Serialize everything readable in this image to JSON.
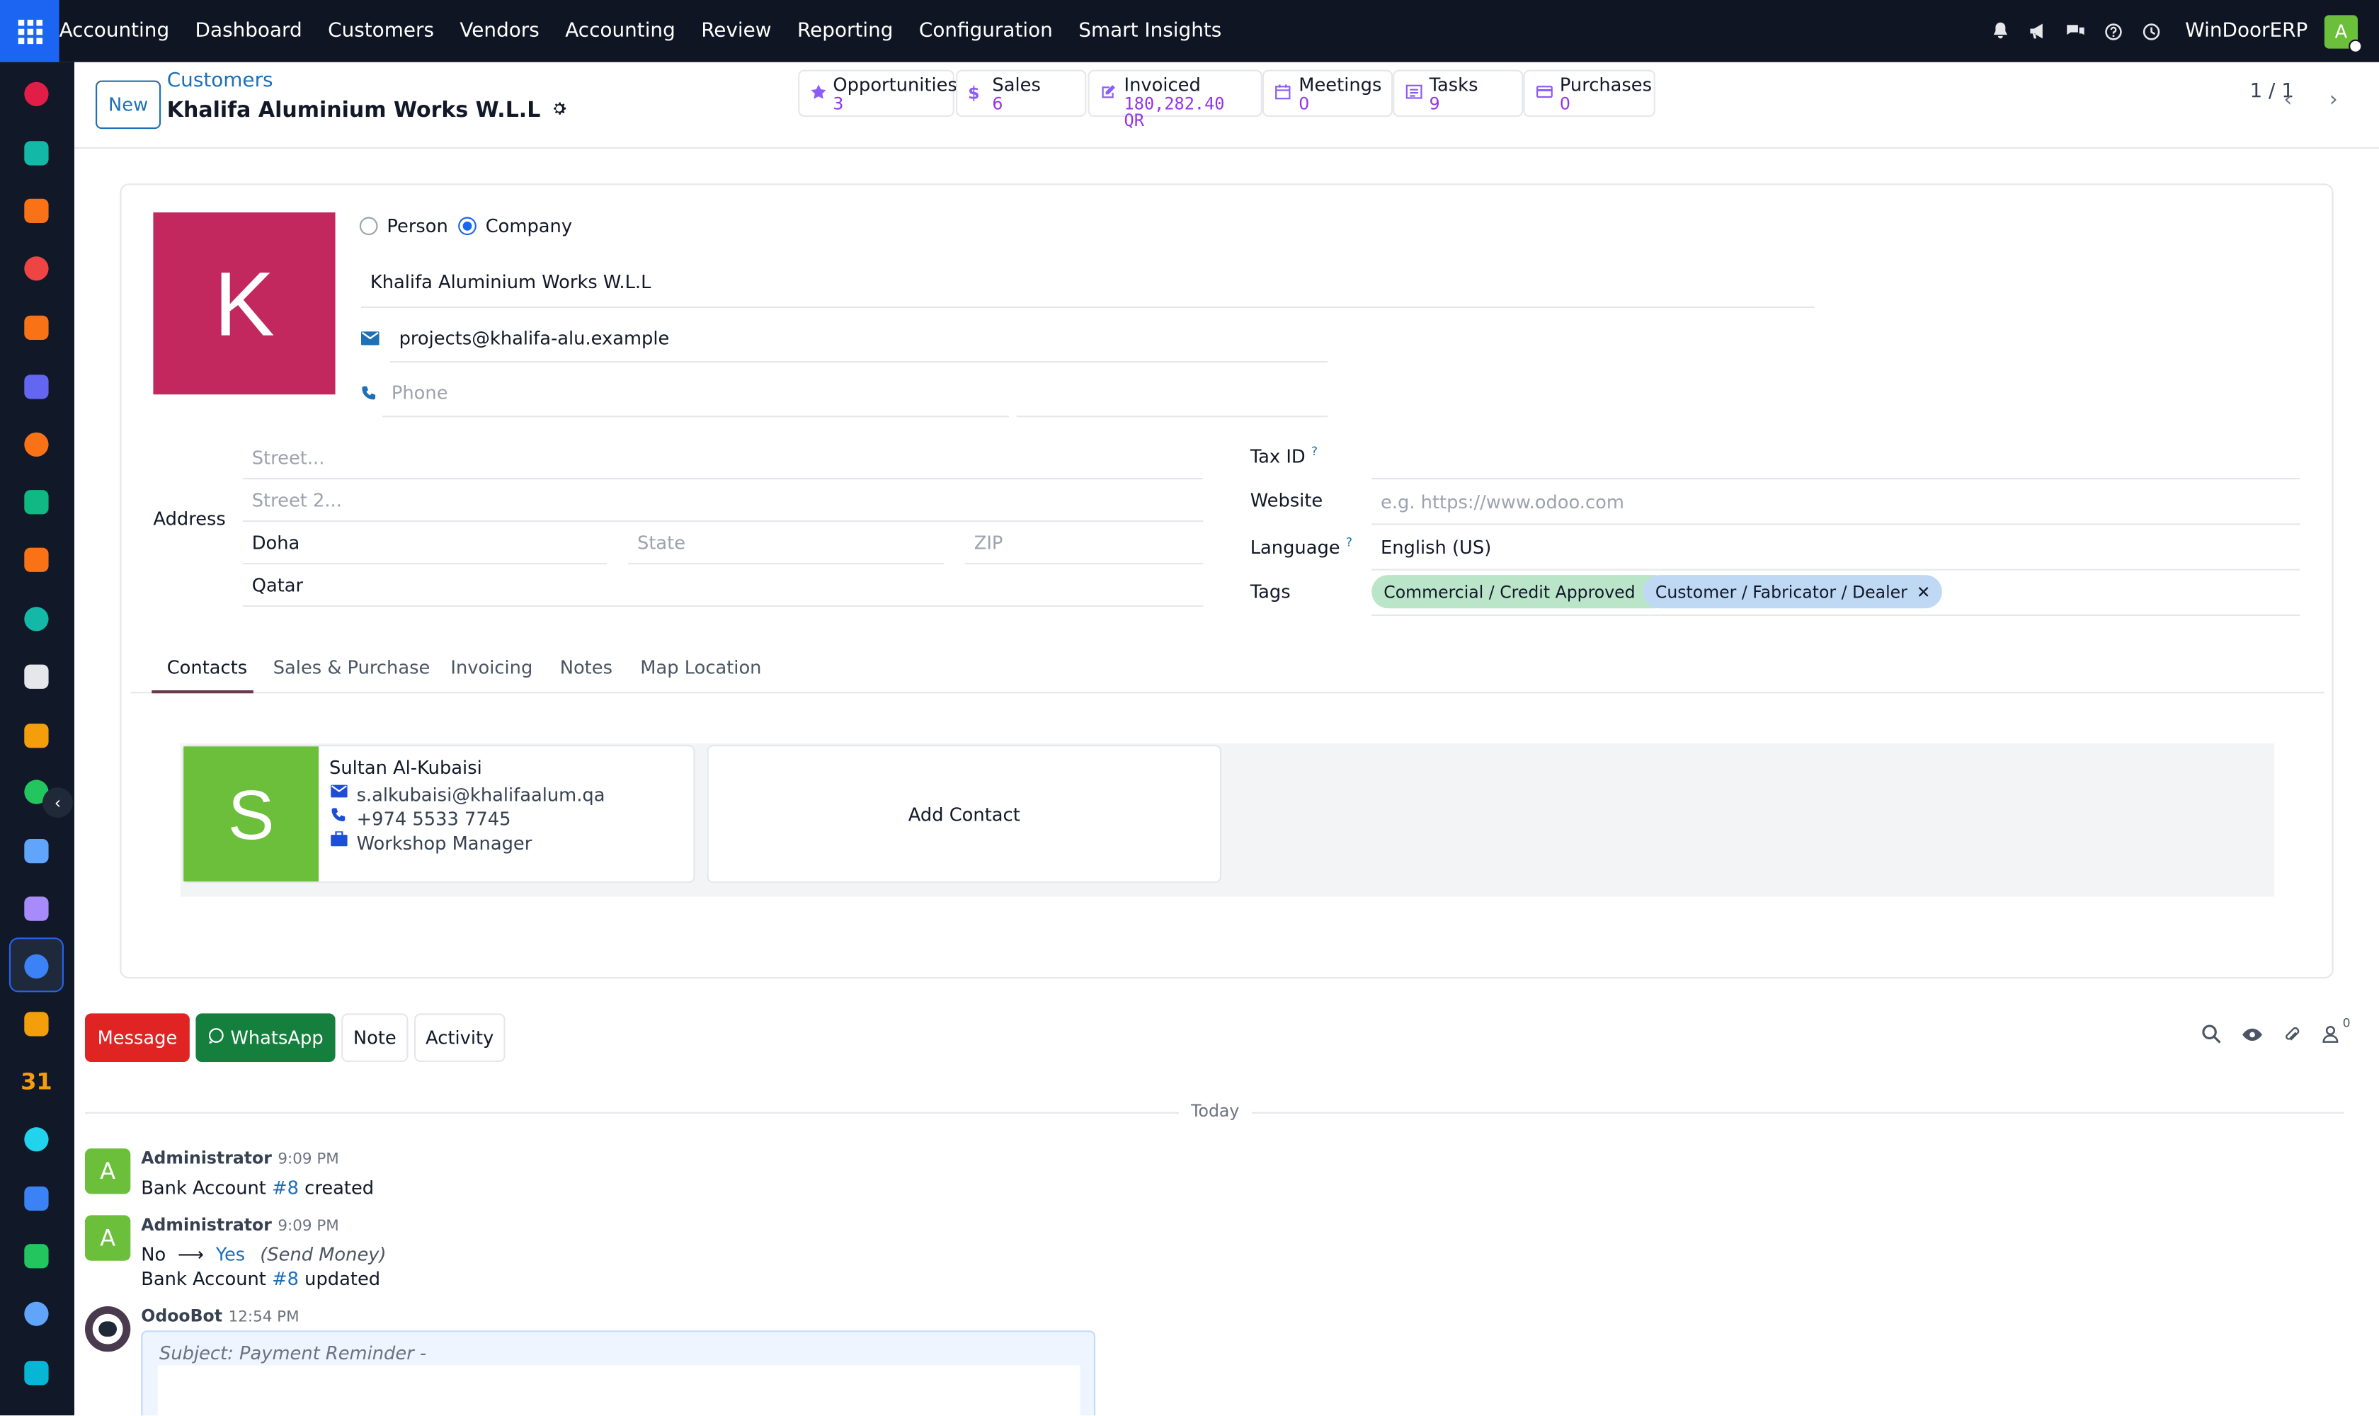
{
  "topbar": {
    "app_name": "Accounting",
    "menu": [
      "Dashboard",
      "Customers",
      "Vendors",
      "Accounting",
      "Review",
      "Reporting",
      "Configuration",
      "Smart Insights"
    ],
    "company": "WinDoorERP",
    "user_initial": "A"
  },
  "sidebar": {
    "apps": [
      {
        "icon": "documents-icon",
        "color": "#e11d48"
      },
      {
        "icon": "contacts-icon",
        "color": "#14b8a6"
      },
      {
        "icon": "sales-icon",
        "color": "#f97316"
      },
      {
        "icon": "dashboards-icon",
        "color": "#ef4444"
      },
      {
        "icon": "discuss-icon",
        "color": "#f97316"
      },
      {
        "icon": "email-marketing-icon",
        "color": "#6366f1"
      },
      {
        "icon": "live-chat-icon",
        "color": "#f97316"
      },
      {
        "icon": "crm-icon",
        "color": "#10b981"
      },
      {
        "icon": "reporting-icon",
        "color": "#f97316"
      },
      {
        "icon": "employees-icon",
        "color": "#14b8a6"
      },
      {
        "icon": "inventory-icon",
        "color": "#e5e7eb"
      },
      {
        "icon": "expenses-icon",
        "color": "#f59e0b"
      },
      {
        "icon": "project-icon",
        "color": "#22c55e"
      },
      {
        "icon": "knowledge-icon",
        "color": "#60a5fa"
      },
      {
        "icon": "purchase-icon",
        "color": "#a78bfa"
      },
      {
        "icon": "invoicing-icon",
        "color": "#3b82f6"
      },
      {
        "icon": "team-icon",
        "color": "#f59e0b"
      },
      {
        "icon": "calendar-icon",
        "color": "#f59e0b",
        "label": "31"
      },
      {
        "icon": "sign-icon",
        "color": "#22d3ee"
      },
      {
        "icon": "studio-icon",
        "color": "#3b82f6"
      },
      {
        "icon": "whatsapp-icon",
        "color": "#22c55e"
      },
      {
        "icon": "timesheets-icon",
        "color": "#60a5fa"
      },
      {
        "icon": "website-icon",
        "color": "#06b6d4"
      }
    ]
  },
  "control_panel": {
    "new_label": "New",
    "breadcrumb": "Customers",
    "title": "Khalifa Aluminium Works W.L.L",
    "pager": "1 / 1",
    "smart_buttons": [
      {
        "label": "Opportunities",
        "value": "3",
        "icon": "star-icon"
      },
      {
        "label": "Sales",
        "value": "6",
        "icon": "dollar-icon"
      },
      {
        "label": "Invoiced",
        "value": "180,282.40 QR",
        "icon": "pencil-square-icon"
      },
      {
        "label": "Meetings",
        "value": "0",
        "icon": "calendar-icon"
      },
      {
        "label": "Tasks",
        "value": "9",
        "icon": "tasks-icon"
      },
      {
        "label": "Purchases",
        "value": "0",
        "icon": "credit-card-icon"
      }
    ]
  },
  "form": {
    "avatar_initial": "K",
    "type_person": "Person",
    "type_company": "Company",
    "name": "Khalifa Aluminium Works W.L.L",
    "email": "projects@khalifa-alu.example",
    "phone_placeholder": "Phone",
    "address_label": "Address",
    "street_placeholder": "Street...",
    "street2_placeholder": "Street 2...",
    "city": "Doha",
    "state_placeholder": "State",
    "zip_placeholder": "ZIP",
    "country": "Qatar",
    "tax_id_label": "Tax ID",
    "website_label": "Website",
    "website_placeholder": "e.g. https://www.odoo.com",
    "language_label": "Language",
    "language": "English (US)",
    "tags_label": "Tags",
    "tags": [
      {
        "label": "Commercial / Credit Approved",
        "color": "#bbe5c9"
      },
      {
        "label": "Customer / Fabricator / Dealer",
        "color": "#bfd9f5"
      }
    ],
    "help_mark": "?"
  },
  "tabs": [
    "Contacts",
    "Sales & Purchase",
    "Invoicing",
    "Notes",
    "Map Location"
  ],
  "contacts": {
    "card": {
      "initial": "S",
      "name": "Sultan Al-Kubaisi",
      "email": "s.alkubaisi@khalifaalum.qa",
      "phone": "+974 5533 7745",
      "job": "Workshop Manager"
    },
    "add_label": "Add Contact"
  },
  "chatter": {
    "buttons": {
      "message": "Message",
      "whatsapp": "WhatsApp",
      "note": "Note",
      "activity": "Activity"
    },
    "follower_count": "0",
    "date_sep": "Today",
    "messages": [
      {
        "author": "Administrator",
        "time": "9:09 PM",
        "pre": "Bank Account ",
        "link": "#8",
        "post": " created"
      },
      {
        "author": "Administrator",
        "time": "9:09 PM",
        "old": "No",
        "arrow": "⟶",
        "new": "Yes",
        "field": "(Send Money)",
        "pre": "Bank Account ",
        "link": "#8",
        "post": " updated"
      },
      {
        "author": "OdooBot",
        "time": "12:54 PM",
        "subject": "Subject: Payment Reminder -"
      }
    ]
  }
}
